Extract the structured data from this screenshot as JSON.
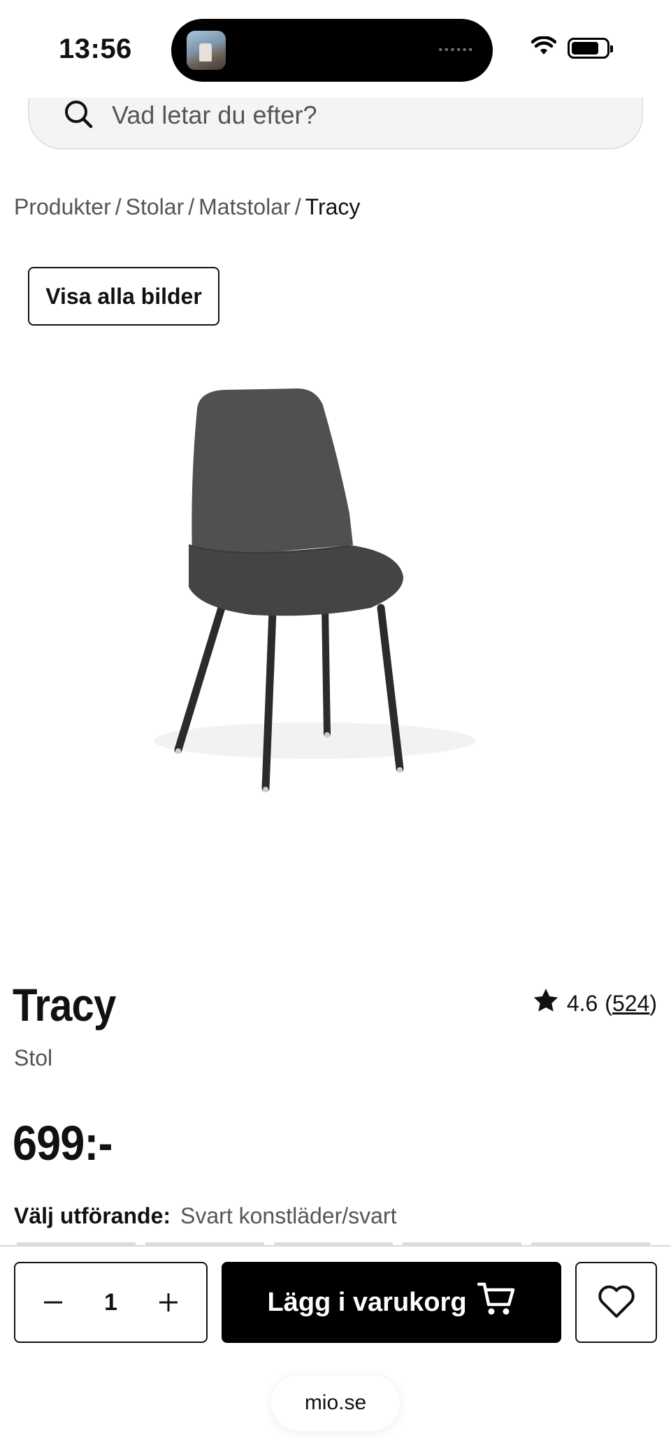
{
  "status_bar": {
    "time": "13:56"
  },
  "search": {
    "placeholder": "Vad letar du efter?"
  },
  "breadcrumb": {
    "items": [
      "Produkter",
      "Stolar",
      "Matstolar"
    ],
    "current": "Tracy",
    "separator": "/"
  },
  "gallery": {
    "show_all_label": "Visa alla bilder"
  },
  "product": {
    "name": "Tracy",
    "type": "Stol",
    "price": "699:-",
    "rating": "4.6",
    "review_count": "524",
    "variant_label": "Välj utförande:",
    "variant_value": "Svart konstläder/svart"
  },
  "purchase": {
    "quantity": "1",
    "add_to_cart_label": "Lägg i varukorg"
  },
  "browser": {
    "url": "mio.se"
  },
  "colors": {
    "primary": "#000000",
    "muted_text": "#555555",
    "chair": "#4a4a4a"
  }
}
